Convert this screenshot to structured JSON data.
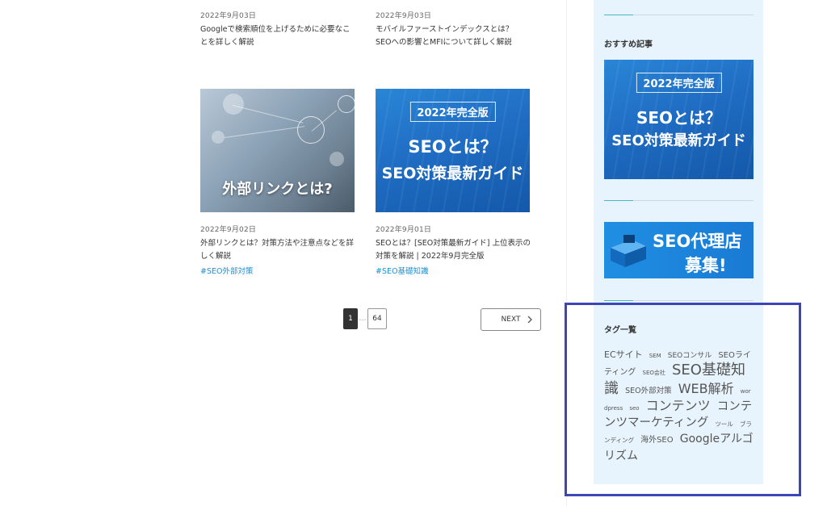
{
  "cards_top": [
    {
      "date": "2022年9月03日",
      "title": "Googleで検索順位を上げるために必要なことを詳しく解説"
    },
    {
      "date": "2022年9月03日",
      "title": "モバイルファーストインデックスとは？　SEOへの影響とMFIについて詳しく解説"
    }
  ],
  "cards_bottom": [
    {
      "thumb_caption": "外部リンクとは?",
      "date": "2022年9月02日",
      "title": "外部リンクとは？対策方法や注意点などを詳しく解説",
      "tag": "#SEO外部対策"
    },
    {
      "thumb_badge": "2022年完全版",
      "thumb_line1": "SEOとは？",
      "thumb_line2": "SEO対策最新ガイド",
      "date": "2022年9月01日",
      "title": "SEOとは？[SEO対策最新ガイド] 上位表示の対策を解説 | 2022年9月完全版",
      "tag": "#SEO基礎知識"
    }
  ],
  "pagination": {
    "current": "1",
    "dots": "…",
    "last": "64",
    "next_label": "NEXT"
  },
  "sidebar": {
    "recommended_heading": "おすすめ記事",
    "recommended_banner": {
      "badge": "2022年完全版",
      "line1": "SEOとは？",
      "line2": "SEO対策最新ガイド"
    },
    "agency_banner": {
      "line1": "SEO代理店",
      "line2": "募集!"
    },
    "tags_heading": "タグ一覧",
    "tags": [
      {
        "label": "ECサイト",
        "size": 11
      },
      {
        "label": "SEM",
        "size": 7
      },
      {
        "label": "SEOコンサル",
        "size": 9
      },
      {
        "label": "SEOライティング",
        "size": 10
      },
      {
        "label": "SEO会社",
        "size": 7
      },
      {
        "label": "SEO基礎知識",
        "size": 18
      },
      {
        "label": "SEO外部対策",
        "size": 9.5
      },
      {
        "label": "WEB解析",
        "size": 16
      },
      {
        "label": "wordpress",
        "size": 7
      },
      {
        "label": "seo",
        "size": 7
      },
      {
        "label": "コンテンツ",
        "size": 16
      },
      {
        "label": "コンテンツマーケティング",
        "size": 14.5
      },
      {
        "label": "ツール",
        "size": 7.5
      },
      {
        "label": "ブランディング",
        "size": 7.5
      },
      {
        "label": "海外SEO",
        "size": 10
      },
      {
        "label": "Googleアルゴリズム",
        "size": 14
      }
    ]
  },
  "colors": {
    "highlight": "#3d46b8",
    "tag_link": "#1d8fd0",
    "sidebar_bg": "#e8f4fd",
    "accent_line": "#4bb7c6"
  }
}
